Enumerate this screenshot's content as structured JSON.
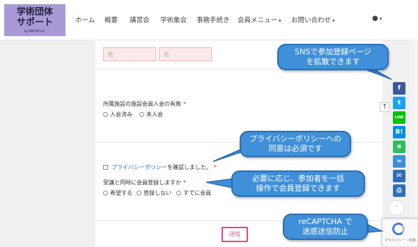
{
  "nav": {
    "logo_line1": "学術団体",
    "logo_line2": "サポート",
    "logo_line3": "by DWUYN LLC",
    "items": [
      "ホーム",
      "概要",
      "講習会",
      "学術集会",
      "事務手続き",
      "会員メニュー",
      "お問い合わせ"
    ],
    "user_icon": "user-icon"
  },
  "form": {
    "name_fields": {
      "last_placeholder": "姓",
      "first_placeholder": "名"
    },
    "membership": {
      "label": "所属施設の施設会員入会の有無",
      "required_mark": "*",
      "options": [
        "入会済み",
        "未入会"
      ]
    },
    "privacy": {
      "link": "プライバシーポリシー",
      "suffix": "を確認しました。",
      "required_mark": "*"
    },
    "register": {
      "label": "受講と同時に会員登録しますか",
      "required_mark": "*",
      "options": [
        "希望する",
        "登録しない",
        "すでに会員"
      ]
    },
    "submit_label": "送信"
  },
  "share_buttons": [
    {
      "name": "facebook",
      "glyph": "f",
      "color": "#3b5998"
    },
    {
      "name": "twitter",
      "glyph": "t",
      "color": "#1da1f2"
    },
    {
      "name": "line",
      "glyph": "LINE",
      "color": "#00c300"
    },
    {
      "name": "hatena",
      "glyph": "B!",
      "color": "#008fde"
    },
    {
      "name": "evernote",
      "glyph": "e",
      "color": "#2dbe60"
    },
    {
      "name": "link",
      "glyph": "∞",
      "color": "#3a8fd9"
    },
    {
      "name": "mail",
      "glyph": "✉",
      "color": "#2e6fb8"
    },
    {
      "name": "print",
      "glyph": "⎙",
      "color": "#2e6fb8"
    }
  ],
  "recaptcha": {
    "text": "プライバシー・利用"
  },
  "callouts": {
    "sns": [
      "SNSで参加登録ページ",
      "を拡散できます"
    ],
    "privacy": [
      "プライバシーポリシーへの",
      "同意は必須です"
    ],
    "register": [
      "必要に応じ、参加者を一括",
      "操作で会員登録できます"
    ],
    "recaptcha": [
      "reCAPTCHA で",
      "迷惑送信防止"
    ]
  }
}
